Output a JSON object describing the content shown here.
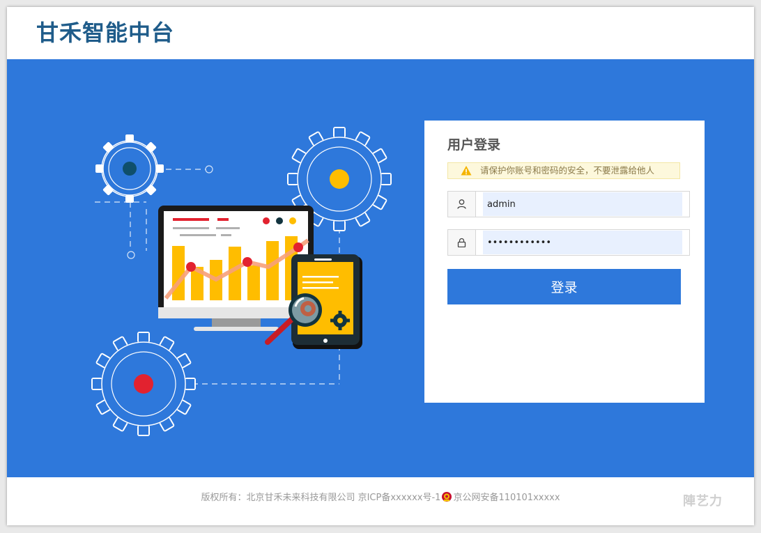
{
  "header": {
    "title": "甘禾智能中台"
  },
  "illustration": {
    "icons": [
      "gear-icon",
      "monitor-chart-icon",
      "tablet-icon",
      "magnifier-icon"
    ],
    "colors": {
      "background": "#2e78db",
      "bar": "#ffbd00",
      "dot": "#e2222f",
      "monitor": "#1a1a1a"
    }
  },
  "login": {
    "title": "用户登录",
    "warning": "请保护你账号和密码的安全，不要泄露给他人",
    "username": {
      "value": "admin",
      "icon": "user-icon"
    },
    "password": {
      "value": "••••••••••••",
      "icon": "lock-icon"
    },
    "submit_label": "登录"
  },
  "footer": {
    "copyright_text": "版权所有：北京甘禾未来科技有限公司 京ICP备xxxxxx号-1",
    "police_text": "京公网安备110101xxxxx",
    "watermark": "陣艺力"
  },
  "colors": {
    "brand_title": "#1f5c8a",
    "primary": "#2e78db",
    "warning_bg": "#fdf8dc"
  }
}
